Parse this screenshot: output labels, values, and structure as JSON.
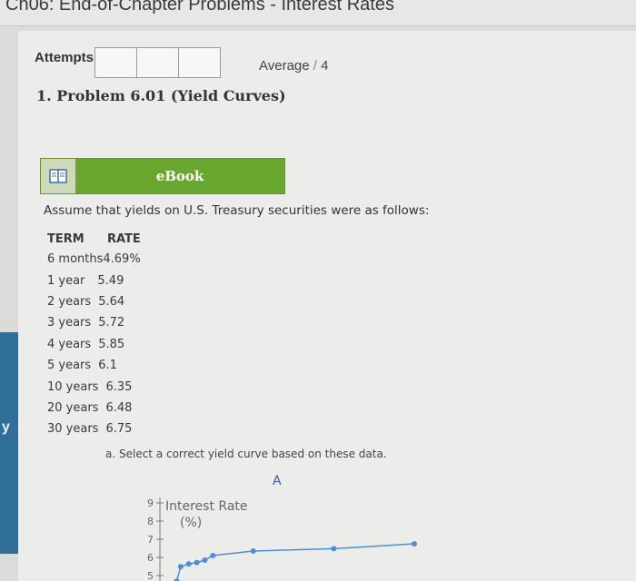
{
  "header": {
    "title": "Ch06: End-of-Chapter Problems - Interest Rates"
  },
  "sidebar": {
    "letter": "y"
  },
  "attempts": {
    "label": "Attempts",
    "boxes": 3
  },
  "average": {
    "label": "Average",
    "value": "4"
  },
  "problem": {
    "title": "1. Problem 6.01 (Yield Curves)"
  },
  "ebook": {
    "label": "eBook",
    "icon": "book-icon"
  },
  "intro": "Assume that yields on U.S. Treasury securities were as follows:",
  "table": {
    "headers": [
      "TERM",
      "RATE"
    ],
    "rows": [
      {
        "term": "6 months",
        "rate": "4.69%"
      },
      {
        "term": "1 year",
        "rate": "5.49"
      },
      {
        "term": "2 years",
        "rate": "5.64"
      },
      {
        "term": "3 years",
        "rate": "5.72"
      },
      {
        "term": "4 years",
        "rate": "5.85"
      },
      {
        "term": "5 years",
        "rate": "6.1"
      },
      {
        "term": "10 years",
        "rate": "6.35"
      },
      {
        "term": "20 years",
        "rate": "6.48"
      },
      {
        "term": "30 years",
        "rate": "6.75"
      }
    ]
  },
  "question": "a. Select a correct yield curve based on these data.",
  "option": "A",
  "chart_data": {
    "type": "line",
    "ylabel": "Interest Rate (%)",
    "yticks": [
      "9",
      "8",
      "7",
      "6",
      "5"
    ],
    "ylim": [
      5,
      9
    ],
    "colors": {
      "line": "#4a8fd8"
    },
    "series": [
      {
        "x": [
          0.5,
          1,
          2,
          3,
          4,
          5,
          10,
          20,
          30
        ],
        "values": [
          4.69,
          5.49,
          5.64,
          5.72,
          5.85,
          6.1,
          6.35,
          6.48,
          6.75
        ]
      }
    ]
  }
}
